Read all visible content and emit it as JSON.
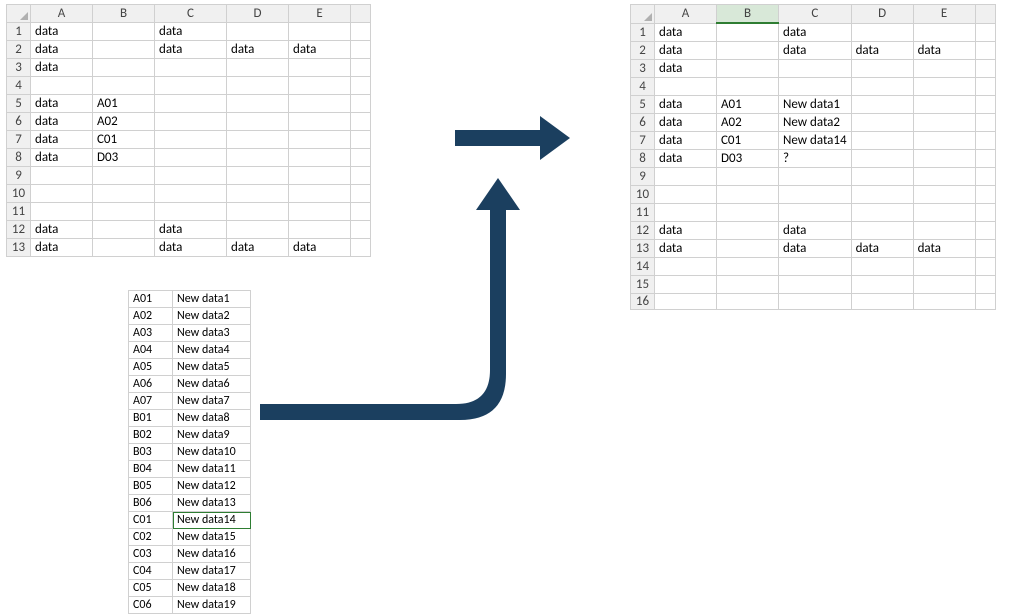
{
  "columns": [
    "A",
    "B",
    "C",
    "D",
    "E"
  ],
  "left_sheet": {
    "rows": [
      {
        "n": "1",
        "A": "data",
        "B": "",
        "C": "data",
        "D": "",
        "E": ""
      },
      {
        "n": "2",
        "A": "data",
        "B": "",
        "C": "data",
        "D": "data",
        "E": "data"
      },
      {
        "n": "3",
        "A": "data",
        "B": "",
        "C": "",
        "D": "",
        "E": ""
      },
      {
        "n": "4",
        "A": "",
        "B": "",
        "C": "",
        "D": "",
        "E": ""
      },
      {
        "n": "5",
        "A": "data",
        "B": "A01",
        "C": "",
        "D": "",
        "E": ""
      },
      {
        "n": "6",
        "A": "data",
        "B": "A02",
        "C": "",
        "D": "",
        "E": ""
      },
      {
        "n": "7",
        "A": "data",
        "B": "C01",
        "C": "",
        "D": "",
        "E": ""
      },
      {
        "n": "8",
        "A": "data",
        "B": "D03",
        "C": "",
        "D": "",
        "E": ""
      },
      {
        "n": "9",
        "A": "",
        "B": "",
        "C": "",
        "D": "",
        "E": ""
      },
      {
        "n": "10",
        "A": "",
        "B": "",
        "C": "",
        "D": "",
        "E": ""
      },
      {
        "n": "11",
        "A": "",
        "B": "",
        "C": "",
        "D": "",
        "E": ""
      },
      {
        "n": "12",
        "A": "data",
        "B": "",
        "C": "data",
        "D": "",
        "E": ""
      },
      {
        "n": "13",
        "A": "data",
        "B": "",
        "C": "data",
        "D": "data",
        "E": "data"
      }
    ]
  },
  "right_sheet": {
    "selected_col": "B",
    "rows": [
      {
        "n": "1",
        "A": "data",
        "B": "",
        "C": "data",
        "D": "",
        "E": ""
      },
      {
        "n": "2",
        "A": "data",
        "B": "",
        "C": "data",
        "D": "data",
        "E": "data"
      },
      {
        "n": "3",
        "A": "data",
        "B": "",
        "C": "",
        "D": "",
        "E": ""
      },
      {
        "n": "4",
        "A": "",
        "B": "",
        "C": "",
        "D": "",
        "E": ""
      },
      {
        "n": "5",
        "A": "data",
        "B": "A01",
        "C": "New data1",
        "D": "",
        "E": ""
      },
      {
        "n": "6",
        "A": "data",
        "B": "A02",
        "C": "New data2",
        "D": "",
        "E": ""
      },
      {
        "n": "7",
        "A": "data",
        "B": "C01",
        "C": "New data14",
        "D": "",
        "E": ""
      },
      {
        "n": "8",
        "A": "data",
        "B": "D03",
        "C": "?",
        "D": "",
        "E": ""
      },
      {
        "n": "9",
        "A": "",
        "B": "",
        "C": "",
        "D": "",
        "E": ""
      },
      {
        "n": "10",
        "A": "",
        "B": "",
        "C": "",
        "D": "",
        "E": ""
      },
      {
        "n": "11",
        "A": "",
        "B": "",
        "C": "",
        "D": "",
        "E": ""
      },
      {
        "n": "12",
        "A": "data",
        "B": "",
        "C": "data",
        "D": "",
        "E": ""
      },
      {
        "n": "13",
        "A": "data",
        "B": "",
        "C": "data",
        "D": "data",
        "E": "data"
      },
      {
        "n": "14",
        "A": "",
        "B": "",
        "C": "",
        "D": "",
        "E": ""
      },
      {
        "n": "15",
        "A": "",
        "B": "",
        "C": "",
        "D": "",
        "E": ""
      },
      {
        "n": "16",
        "A": "",
        "B": "",
        "C": "",
        "D": "",
        "E": ""
      }
    ]
  },
  "lookup_table": {
    "selected_row_index": 13,
    "rows": [
      {
        "key": "A01",
        "val": "New data1"
      },
      {
        "key": "A02",
        "val": "New data2"
      },
      {
        "key": "A03",
        "val": "New data3"
      },
      {
        "key": "A04",
        "val": "New data4"
      },
      {
        "key": "A05",
        "val": "New data5"
      },
      {
        "key": "A06",
        "val": "New data6"
      },
      {
        "key": "A07",
        "val": "New data7"
      },
      {
        "key": "B01",
        "val": "New data8"
      },
      {
        "key": "B02",
        "val": "New data9"
      },
      {
        "key": "B03",
        "val": "New data10"
      },
      {
        "key": "B04",
        "val": "New data11"
      },
      {
        "key": "B05",
        "val": "New data12"
      },
      {
        "key": "B06",
        "val": "New data13"
      },
      {
        "key": "C01",
        "val": "New data14"
      },
      {
        "key": "C02",
        "val": "New data15"
      },
      {
        "key": "C03",
        "val": "New data16"
      },
      {
        "key": "C04",
        "val": "New data17"
      },
      {
        "key": "C05",
        "val": "New data18"
      },
      {
        "key": "C06",
        "val": "New data19"
      }
    ]
  },
  "arrow_color": "#1b3f5f"
}
